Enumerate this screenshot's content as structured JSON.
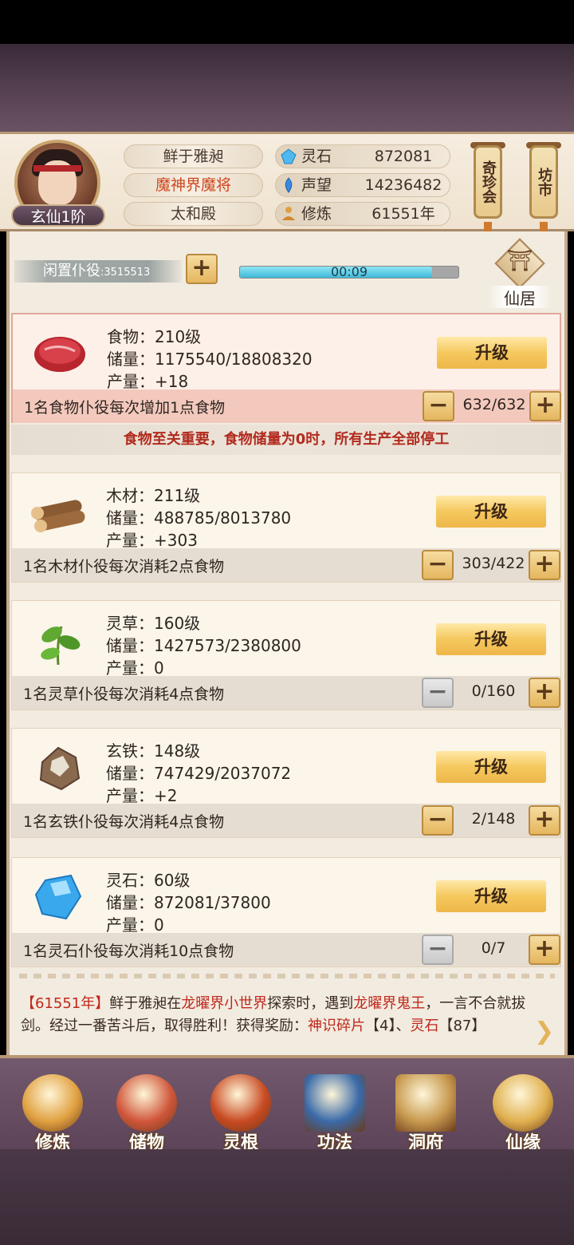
{
  "player": {
    "name": "鲜于雅昶",
    "title": "魔神界魔将",
    "hall": "太和殿",
    "rank": "玄仙1阶"
  },
  "stats": {
    "spirit_stone_label": "灵石",
    "spirit_stone_value": "872081",
    "reputation_label": "声望",
    "reputation_value": "14236482",
    "cultivation_label": "修炼",
    "cultivation_value": "61551年"
  },
  "side_buttons": {
    "treasure": "奇珍会",
    "market": "坊市"
  },
  "idle": {
    "label": "闲置仆役",
    "separator": ":",
    "value": "3515513",
    "timer": "00:09",
    "timer_progress": 0.88
  },
  "residence": {
    "label": "仙居",
    "glyph": "⛩"
  },
  "resources": [
    {
      "name_line": "食物：210级",
      "storage_line": "储量：1175540/18808320",
      "output_line": "产量：+18",
      "upgrade": "升级",
      "desc": "1名食物仆役每次增加1点食物",
      "count": "632/632",
      "icon": "meat-icon"
    },
    {
      "name_line": "木材：211级",
      "storage_line": "储量：488785/8013780",
      "output_line": "产量：+303",
      "upgrade": "升级",
      "desc": "1名木材仆役每次消耗2点食物",
      "count": "303/422",
      "icon": "wood-icon"
    },
    {
      "name_line": "灵草：160级",
      "storage_line": "储量：1427573/2380800",
      "output_line": "产量：0",
      "upgrade": "升级",
      "desc": "1名灵草仆役每次消耗4点食物",
      "count": "0/160",
      "icon": "herb-icon"
    },
    {
      "name_line": "玄铁：148级",
      "storage_line": "储量：747429/2037072",
      "output_line": "产量：+2",
      "upgrade": "升级",
      "desc": "1名玄铁仆役每次消耗4点食物",
      "count": "2/148",
      "icon": "ore-icon"
    },
    {
      "name_line": "灵石：60级",
      "storage_line": "储量：872081/37800",
      "output_line": "产量：0",
      "upgrade": "升级",
      "desc": "1名灵石仆役每次消耗10点食物",
      "count": "0/7",
      "icon": "crystal-icon"
    }
  ],
  "warning": "食物至关重要，食物储量为0时，所有生产全部停工",
  "log": {
    "year": "【61551年】",
    "p1": "鲜于雅昶在",
    "place": "龙曜界小世界",
    "p2": "探索时，遇到",
    "enemy": "龙曜界鬼王",
    "p3": "，一言不合就拔剑。经过一番苦斗后，取得胜利！获得奖励：",
    "reward1": "神识碎片",
    "reward1_qty": "【4】",
    "sep": "、",
    "reward2": "灵石",
    "reward2_qty": "【87】"
  },
  "nav": [
    {
      "label": "修炼",
      "icon": "cultivate-icon",
      "color": "#e0a040"
    },
    {
      "label": "储物",
      "icon": "storage-bag-icon",
      "color": "#d0563a"
    },
    {
      "label": "灵根",
      "icon": "spirit-root-icon",
      "color": "#c84a22"
    },
    {
      "label": "功法",
      "icon": "technique-book-icon",
      "color": "#3a6aa8"
    },
    {
      "label": "洞府",
      "icon": "cave-dwelling-icon",
      "color": "#c89a50"
    },
    {
      "label": "仙缘",
      "icon": "fate-gourd-icon",
      "color": "#e0b050"
    }
  ],
  "colors": {
    "accent_gold": "#f5c85e",
    "warning_red": "#b22a1e",
    "timer_cyan": "#3fb8d8"
  }
}
